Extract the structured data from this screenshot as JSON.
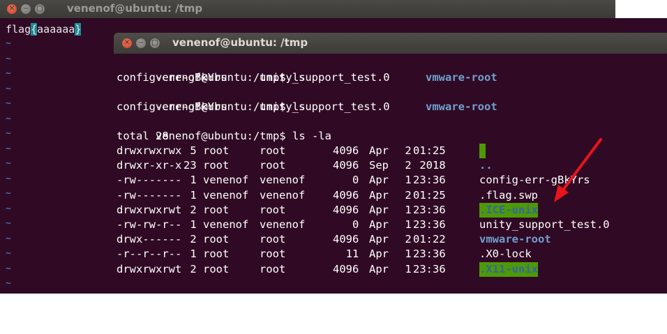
{
  "back_window": {
    "title": "venenof@ubuntu: /tmp",
    "vim_text_prefix": "flag",
    "vim_brace_open": "{",
    "vim_content": "aaaaaa",
    "vim_brace_close": "}",
    "tilde": "~"
  },
  "front_window": {
    "title": "venenof@ubuntu: /tmp",
    "prompt": "venenof@ubuntu:/tmp$",
    "cmd_ls": "ls",
    "cmd_ls_la": "ls -la",
    "ls_output": {
      "item1": "config-err-gBkYrs",
      "item2": "unity_support_test.0",
      "item3": "vmware-root"
    },
    "total": "total 28",
    "listing": [
      {
        "perm": "drwxrwxrwx",
        "links": " 5",
        "owner": "root",
        "group": "root",
        "size": "4096",
        "month": "Apr",
        "day": " 2",
        "time": "01:25",
        "name": ".",
        "style": "greenbox"
      },
      {
        "perm": "drwxr-xr-x",
        "links": "23",
        "owner": "root",
        "group": "root",
        "size": "4096",
        "month": "Sep",
        "day": " 2",
        "time": " 2018",
        "name": "..",
        "style": "blue"
      },
      {
        "perm": "-rw-------",
        "links": " 1",
        "owner": "venenof",
        "group": "venenof",
        "size": "   0",
        "month": "Apr",
        "day": " 1",
        "time": "23:36",
        "name": "config-err-gBkYrs",
        "style": "plain"
      },
      {
        "perm": "-rw-------",
        "links": " 1",
        "owner": "venenof",
        "group": "venenof",
        "size": "4096",
        "month": "Apr",
        "day": " 2",
        "time": "01:25",
        "name": ".flag.swp",
        "style": "plain"
      },
      {
        "perm": "drwxrwxrwt",
        "links": " 2",
        "owner": "root",
        "group": "root",
        "size": "4096",
        "month": "Apr",
        "day": " 1",
        "time": "23:36",
        "name": ".ICE-unix",
        "style": "green"
      },
      {
        "perm": "-rw-rw-r--",
        "links": " 1",
        "owner": "venenof",
        "group": "venenof",
        "size": "   0",
        "month": "Apr",
        "day": " 1",
        "time": "23:36",
        "name": "unity_support_test.0",
        "style": "plain"
      },
      {
        "perm": "drwx------",
        "links": " 2",
        "owner": "root",
        "group": "root",
        "size": "4096",
        "month": "Apr",
        "day": " 2",
        "time": "01:22",
        "name": "vmware-root",
        "style": "blue"
      },
      {
        "perm": "-r--r--r--",
        "links": " 1",
        "owner": "root",
        "group": "root",
        "size": "  11",
        "month": "Apr",
        "day": " 1",
        "time": "23:36",
        "name": ".X0-lock",
        "style": "plain"
      },
      {
        "perm": "drwxrwxrwt",
        "links": " 2",
        "owner": "root",
        "group": "root",
        "size": "4096",
        "month": "Apr",
        "day": " 1",
        "time": "23:36",
        "name": ".X11-unix",
        "style": "green"
      }
    ]
  },
  "colors": {
    "terminal_bg": "#300a24",
    "directory_blue": "#729fcf",
    "sticky_dir_bg": "#4e9a06",
    "annotation_arrow": "#e8141c"
  },
  "icons": [
    "close-icon",
    "minimize-icon",
    "maximize-icon",
    "red-annotation-arrow-icon"
  ]
}
